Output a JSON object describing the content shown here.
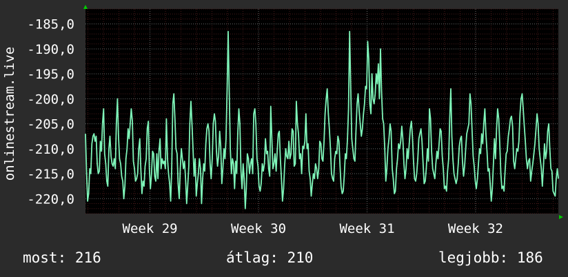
{
  "stats": {
    "current_label": "most:",
    "current_value": "216",
    "average_label": "átlag:",
    "average_value": "210",
    "best_label": "legjobb:",
    "best_value": "186"
  },
  "colors": {
    "background": "#2b2b2b",
    "plot_background": "#000000",
    "grid_major": "#6a6a6a",
    "grid_minor": "#4a1a1a",
    "series_line": "#7ff5b9",
    "axis_arrow": "#00cc00",
    "text": "#ffffff"
  },
  "chart_data": {
    "type": "line",
    "ylabel": "onlinestream.live",
    "yticks": [
      -185,
      -190,
      -195,
      -200,
      -205,
      -210,
      -215,
      -220
    ],
    "ytick_labels": [
      "-185,0",
      "-190,0",
      "-195,0",
      "-200,0",
      "-205,0",
      "-210,0",
      "-215,0",
      "-220,0"
    ],
    "ylim": [
      -223,
      -182
    ],
    "xlim": [
      0,
      440
    ],
    "xticks": [
      {
        "x": 60,
        "label": "Week 29"
      },
      {
        "x": 161,
        "label": "Week 30"
      },
      {
        "x": 262,
        "label": "Week 31"
      },
      {
        "x": 363,
        "label": "Week 32"
      }
    ],
    "grid": true,
    "series": [
      {
        "values": [
          -207,
          -214.5,
          -220.5,
          -219,
          -214,
          -215,
          -209,
          -207.5,
          -207,
          -208.5,
          -207.5,
          -213,
          -215,
          -214.5,
          -208.5,
          -210.5,
          -205,
          -202,
          -211,
          -213,
          -216.5,
          -217.5,
          -210,
          -207.5,
          -211.5,
          -213,
          -213.5,
          -212,
          -214,
          -205,
          -200,
          -207.5,
          -212,
          -213,
          -215.5,
          -216.5,
          -220,
          -217.5,
          -212,
          -210,
          -206,
          -208,
          -205,
          -202,
          -204.5,
          -212.5,
          -214,
          -216.5,
          -216,
          -215,
          -210,
          -208,
          -214,
          -219,
          -216.5,
          -217.5,
          -213.5,
          -212,
          -206,
          -204.5,
          -214,
          -218,
          -215,
          -210.5,
          -211,
          -215.5,
          -216.5,
          -211,
          -216,
          -210.5,
          -208,
          -214,
          -212,
          -213,
          -212.5,
          -214,
          -204,
          -212,
          -215,
          -217,
          -220.5,
          -214,
          -201,
          -199,
          -204,
          -210,
          -211,
          -217,
          -220,
          -214,
          -210,
          -212,
          -214,
          -212.5,
          -216,
          -221,
          -217.5,
          -213.5,
          -205,
          -200.5,
          -205,
          -210,
          -215.5,
          -212,
          -219.5,
          -217,
          -215,
          -212,
          -214,
          -221,
          -216,
          -213,
          -214.5,
          -209,
          -206,
          -205,
          -206.5,
          -213,
          -216,
          -212,
          -205,
          -203,
          -204.5,
          -210.5,
          -213.5,
          -211.5,
          -206.5,
          -209.5,
          -217,
          -214,
          -210,
          -212,
          -208,
          -198,
          -186.5,
          -199,
          -210,
          -215,
          -212,
          -213,
          -218,
          -212.5,
          -215,
          -207,
          -202,
          -205,
          -214.5,
          -218,
          -213,
          -216,
          -222,
          -218,
          -211,
          -212,
          -215,
          -213,
          -212,
          -215,
          -203,
          -202,
          -205,
          -212,
          -213.5,
          -217.5,
          -218.5,
          -217,
          -213,
          -214.5,
          -213,
          -208,
          -211,
          -210.5,
          -214,
          -215.5,
          -201.5,
          -208,
          -214,
          -213,
          -211,
          -214.5,
          -210.5,
          -207,
          -206.5,
          -212,
          -216,
          -220.5,
          -218,
          -213.5,
          -210,
          -211.5,
          -212,
          -208.5,
          -212,
          -211,
          -206,
          -206.5,
          -213.5,
          -213,
          -200.5,
          -205,
          -207,
          -212,
          -211,
          -215,
          -209.5,
          -210,
          -208.5,
          -203,
          -210,
          -209,
          -214.5,
          -216,
          -219.5,
          -217,
          -215,
          -216,
          -213,
          -214,
          -216,
          -214,
          -208.5,
          -209,
          -212,
          -212.5,
          -208.5,
          -203,
          -200,
          -198,
          -203,
          -206,
          -210,
          -215,
          -216,
          -216.5,
          -212,
          -210.5,
          -211,
          -207.5,
          -208.5,
          -213.5,
          -217.5,
          -219,
          -218.5,
          -215.5,
          -211,
          -212,
          -208,
          -202,
          -186.5,
          -197,
          -208,
          -210,
          -212,
          -212.5,
          -206.5,
          -201,
          -199,
          -202.5,
          -205,
          -207.5,
          -206,
          -203,
          -201,
          -197.5,
          -198,
          -188.5,
          -192,
          -201,
          -203,
          -195,
          -200,
          -201,
          -199,
          -195,
          -197,
          -193,
          -200,
          -190,
          -198.5,
          -204,
          -205,
          -210,
          -216.5,
          -214,
          -210,
          -208,
          -205,
          -206.5,
          -214,
          -216,
          -219,
          -218.5,
          -214,
          -212,
          -209,
          -210,
          -208.5,
          -205.5,
          -208,
          -213,
          -216,
          -214,
          -210,
          -212,
          -209,
          -206,
          -204.5,
          -207.5,
          -212.5,
          -216,
          -216.5,
          -215,
          -212,
          -208,
          -207,
          -206,
          -208.5,
          -213,
          -217,
          -216.5,
          -214,
          -210,
          -212.5,
          -202,
          -204,
          -210.5,
          -214,
          -215,
          -216,
          -213,
          -210.5,
          -212,
          -209,
          -206,
          -206.5,
          -211.5,
          -214,
          -218,
          -217.5,
          -218.5,
          -214.5,
          -212,
          -204,
          -198,
          -207.5,
          -212,
          -215,
          -216,
          -217,
          -216,
          -213,
          -209.5,
          -208,
          -207.5,
          -212.5,
          -215.5,
          -213.5,
          -210,
          -207,
          -206,
          -205,
          -199,
          -201,
          -206.5,
          -211.5,
          -213.5,
          -216.5,
          -218,
          -216,
          -213,
          -210,
          -211,
          -207,
          -209,
          -205,
          -202,
          -207,
          -210.5,
          -214.5,
          -214,
          -217,
          -220.5,
          -218,
          -213,
          -208,
          -212,
          -206,
          -202,
          -204,
          -209,
          -215,
          -218,
          -217.5,
          -218.5,
          -214.5,
          -211,
          -210.5,
          -207.5,
          -206,
          -204,
          -203.5,
          -205.5,
          -212.5,
          -214,
          -212,
          -210,
          -210.5,
          -208.5,
          -203,
          -200,
          -199,
          -202,
          -205.5,
          -208.5,
          -212,
          -214,
          -212.5,
          -212,
          -216.5,
          -214.5,
          -213,
          -211,
          -209,
          -206,
          -203,
          -205,
          -210,
          -212,
          -214,
          -217.5,
          -213.5,
          -209,
          -212,
          -210.5,
          -206.5,
          -205,
          -210,
          -214,
          -214.5,
          -218.5,
          -219,
          -219.5,
          -216,
          -214,
          -216
        ]
      }
    ]
  }
}
